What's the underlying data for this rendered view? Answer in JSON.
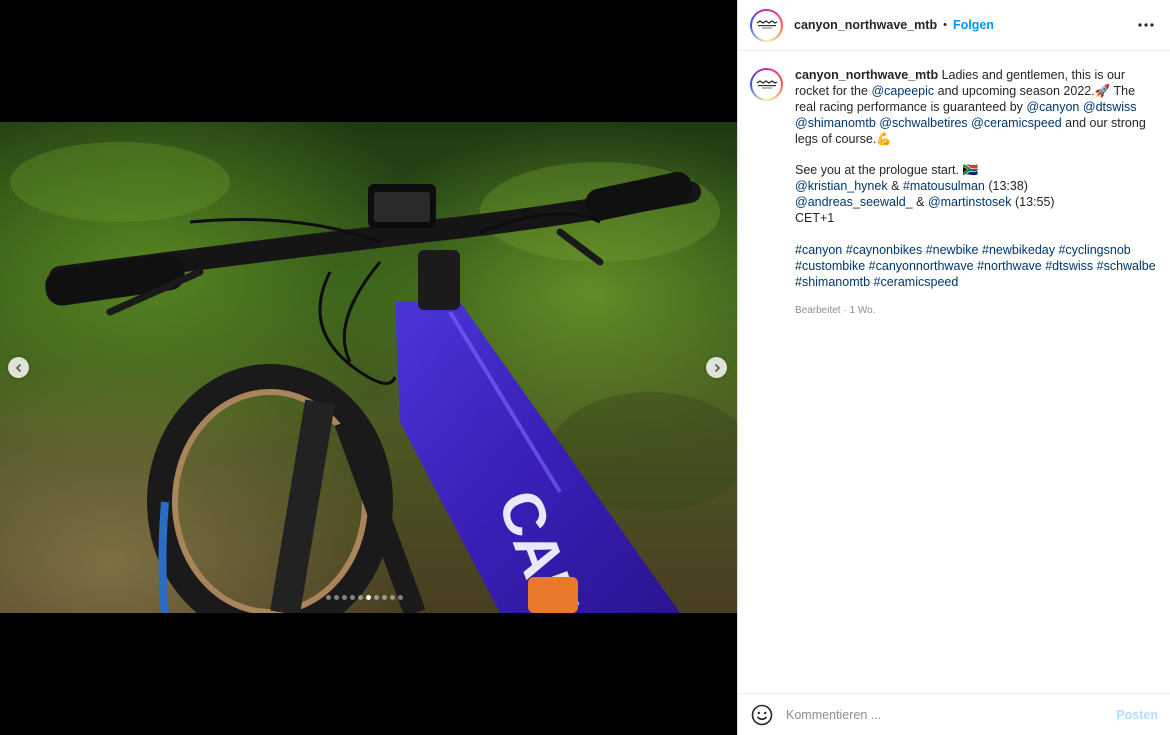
{
  "post": {
    "username": "canyon_northwave_mtb",
    "separator": "•",
    "follow_label": "Folgen",
    "avatar_logo": "canyon-northwave-logo"
  },
  "caption": {
    "username": "canyon_northwave_mtb",
    "p1_t1": " Ladies and gentlemen, this is our rocket for the ",
    "p1_m1": "@capeepic",
    "p1_t2": " and upcoming season 2022.🚀 The real racing performance is guaranteed by ",
    "p1_m2": "@canyon",
    "p1_t3": " ",
    "p1_m3": "@dtswiss",
    "p1_t4": " ",
    "p1_m4": "@shimanomtb",
    "p1_t5": " ",
    "p1_m5": "@schwalbetires",
    "p1_t6": " ",
    "p1_m6": "@ceramicspeed",
    "p1_t7": " and our strong legs of course.💪",
    "p2_l1": "See you at the prologue start. 🇿🇦",
    "p2_l2_m1": "@kristian_hynek",
    "p2_l2_t1": " & ",
    "p2_l2_m2": "#matousulman",
    "p2_l2_t2": " (13:38)",
    "p2_l3_m1": "@andreas_seewald_",
    "p2_l3_t1": " & ",
    "p2_l3_m2": "@martinstosek",
    "p2_l3_t2": " (13:55)",
    "p2_l4": "CET+1",
    "hashtags": [
      "#canyon",
      "#caynonbikes",
      "#newbike",
      "#newbikeday",
      "#cyclingsnob",
      "#custombike",
      "#canyonnorthwave",
      "#northwave",
      "#dtswiss",
      "#schwalbe",
      "#shimanomtb",
      "#ceramicspeed"
    ],
    "meta": "Bearbeitet · 1 Wo."
  },
  "carousel": {
    "total": 10,
    "active": 6
  },
  "footer": {
    "placeholder": "Kommentieren ...",
    "post_label": "Posten"
  },
  "icons": {
    "prev": "chevron-left-icon",
    "next": "chevron-right-icon",
    "more": "more-horizontal-icon",
    "emoji": "emoji-smiley-icon"
  }
}
